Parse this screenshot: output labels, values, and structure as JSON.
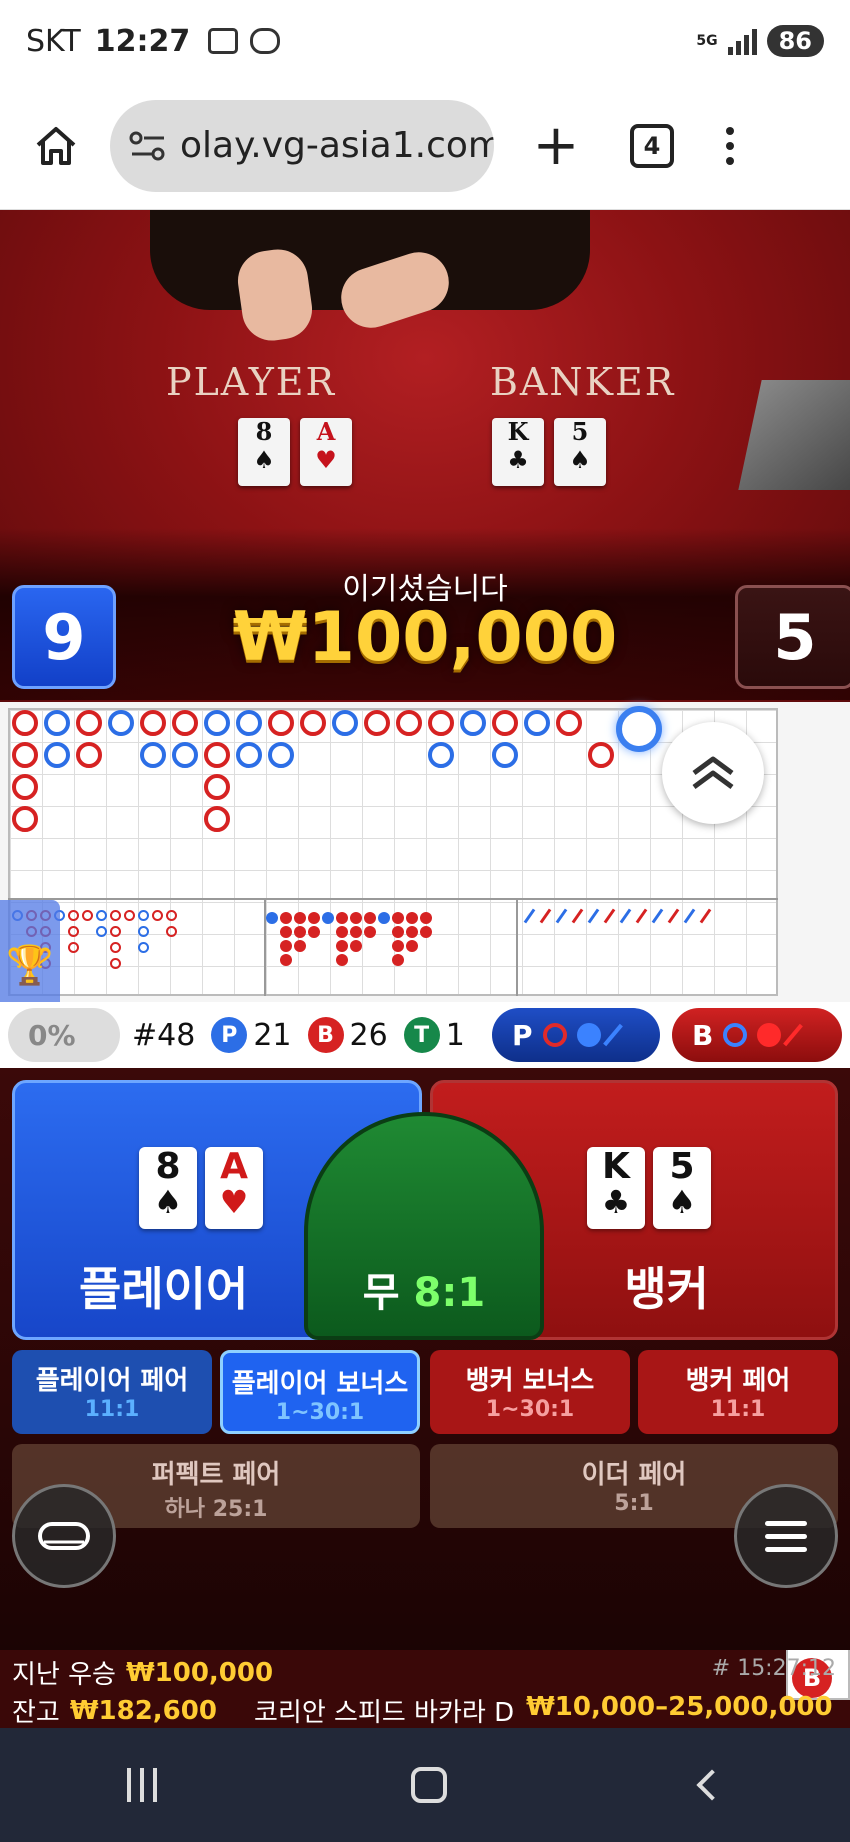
{
  "status_bar": {
    "carrier": "SKT",
    "time": "12:27",
    "network": "5G",
    "battery": "86"
  },
  "browser": {
    "url": "olay.vg-asia1.com",
    "tab_count": "4"
  },
  "video": {
    "player_label": "PLAYER",
    "banker_label": "BANKER",
    "player_cards": [
      {
        "rank": "8",
        "suit": "♠",
        "color": "black"
      },
      {
        "rank": "A",
        "suit": "♥",
        "color": "red"
      }
    ],
    "banker_cards": [
      {
        "rank": "K",
        "suit": "♣",
        "color": "black"
      },
      {
        "rank": "5",
        "suit": "♠",
        "color": "black"
      }
    ],
    "player_score": "9",
    "banker_score": "5",
    "win_message": "이기셨습니다",
    "win_amount": "₩100,000"
  },
  "stats": {
    "percent": "0%",
    "round": "#48",
    "player_letter": "P",
    "player_count": "21",
    "banker_letter": "B",
    "banker_count": "26",
    "tie_letter": "T",
    "tie_count": "1",
    "predict_player": "P",
    "predict_banker": "B"
  },
  "side_history": [
    "P",
    "B",
    "P",
    "P",
    "B",
    "B"
  ],
  "betting": {
    "player_label": "플레이어",
    "banker_label": "뱅커",
    "tie_label": "무",
    "tie_odds": "8:1",
    "player_pair": {
      "label": "플레이어 페어",
      "odds": "11:1"
    },
    "player_bonus": {
      "label": "플레이어 보너스",
      "odds": "1~30:1"
    },
    "banker_bonus": {
      "label": "뱅커 보너스",
      "odds": "1~30:1"
    },
    "banker_pair": {
      "label": "뱅커 페어",
      "odds": "11:1"
    },
    "perfect_pair": {
      "label": "퍼펙트 페어",
      "odds": "하나 25:1"
    },
    "either_pair": {
      "label": "이더 페어",
      "odds": "5:1"
    }
  },
  "info": {
    "last_win_label": "지난 우승",
    "last_win_amount": "₩100,000",
    "timestamp": "# 15:27:12",
    "balance_label": "잔고",
    "balance_amount": "₩182,600",
    "table_name": "코리안 스피드 바카라 D",
    "bet_limits": "₩10,000–25,000,000"
  },
  "colors": {
    "player": "#2c6ee6",
    "banker": "#d62222",
    "tie": "#16884a",
    "gold": "#ffcc33"
  }
}
